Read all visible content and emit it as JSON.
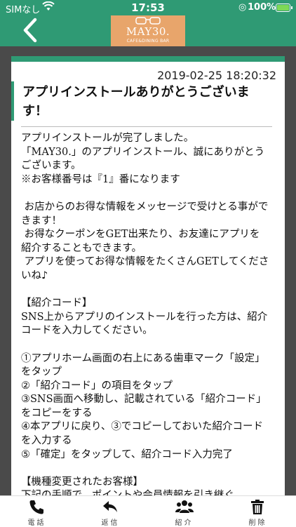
{
  "status_bar": {
    "carrier": "SIMなし",
    "time": "17:53",
    "battery": "100%",
    "battery_level": 1.0
  },
  "header": {
    "back_icon": "chevron-left-icon",
    "logo_name": "MAY30.",
    "logo_sub": "CAFE&DINING BAR",
    "brand_color": "#2f9a74",
    "logo_color": "#e8a56b"
  },
  "message": {
    "date": "2019-02-25 18:20:32",
    "title": "アプリインストールありがとうございます！",
    "body": "アプリインストールが完了しました。\n「MAY30.」のアプリインストール、誠にありがとうございます。\n※お客様番号は『1』番になります\n\n お店からのお得な情報をメッセージで受けとる事ができます！\n お得なクーポンをGET出来たり、お友達にアプリを紹介することもできます。\n アプリを使ってお得な情報をたくさんGETしてくださいね♪\n\n【紹介コード】\nSNS上からアプリのインストールを行った方は、紹介コードを入力してください。\n\n①アプリホーム画面の右上にある歯車マーク「設定」をタップ\n②「紹介コード」の項目をタップ\n③SNS画面へ移動し、記載されている「紹介コード」をコピーをする\n④本アプリに戻り、③でコピーしておいた紹介コードを入力する\n⑤「確定」をタップして、紹介コード入力完了\n\n【機種変更されたお客様】\n下記の手順で、ポイントや会員情報を引き継ぐ"
  },
  "tabs": [
    {
      "label": "電話",
      "icon": "phone-icon"
    },
    {
      "label": "返信",
      "icon": "reply-icon"
    },
    {
      "label": "紹介",
      "icon": "users-icon"
    },
    {
      "label": "削除",
      "icon": "trash-icon"
    }
  ]
}
